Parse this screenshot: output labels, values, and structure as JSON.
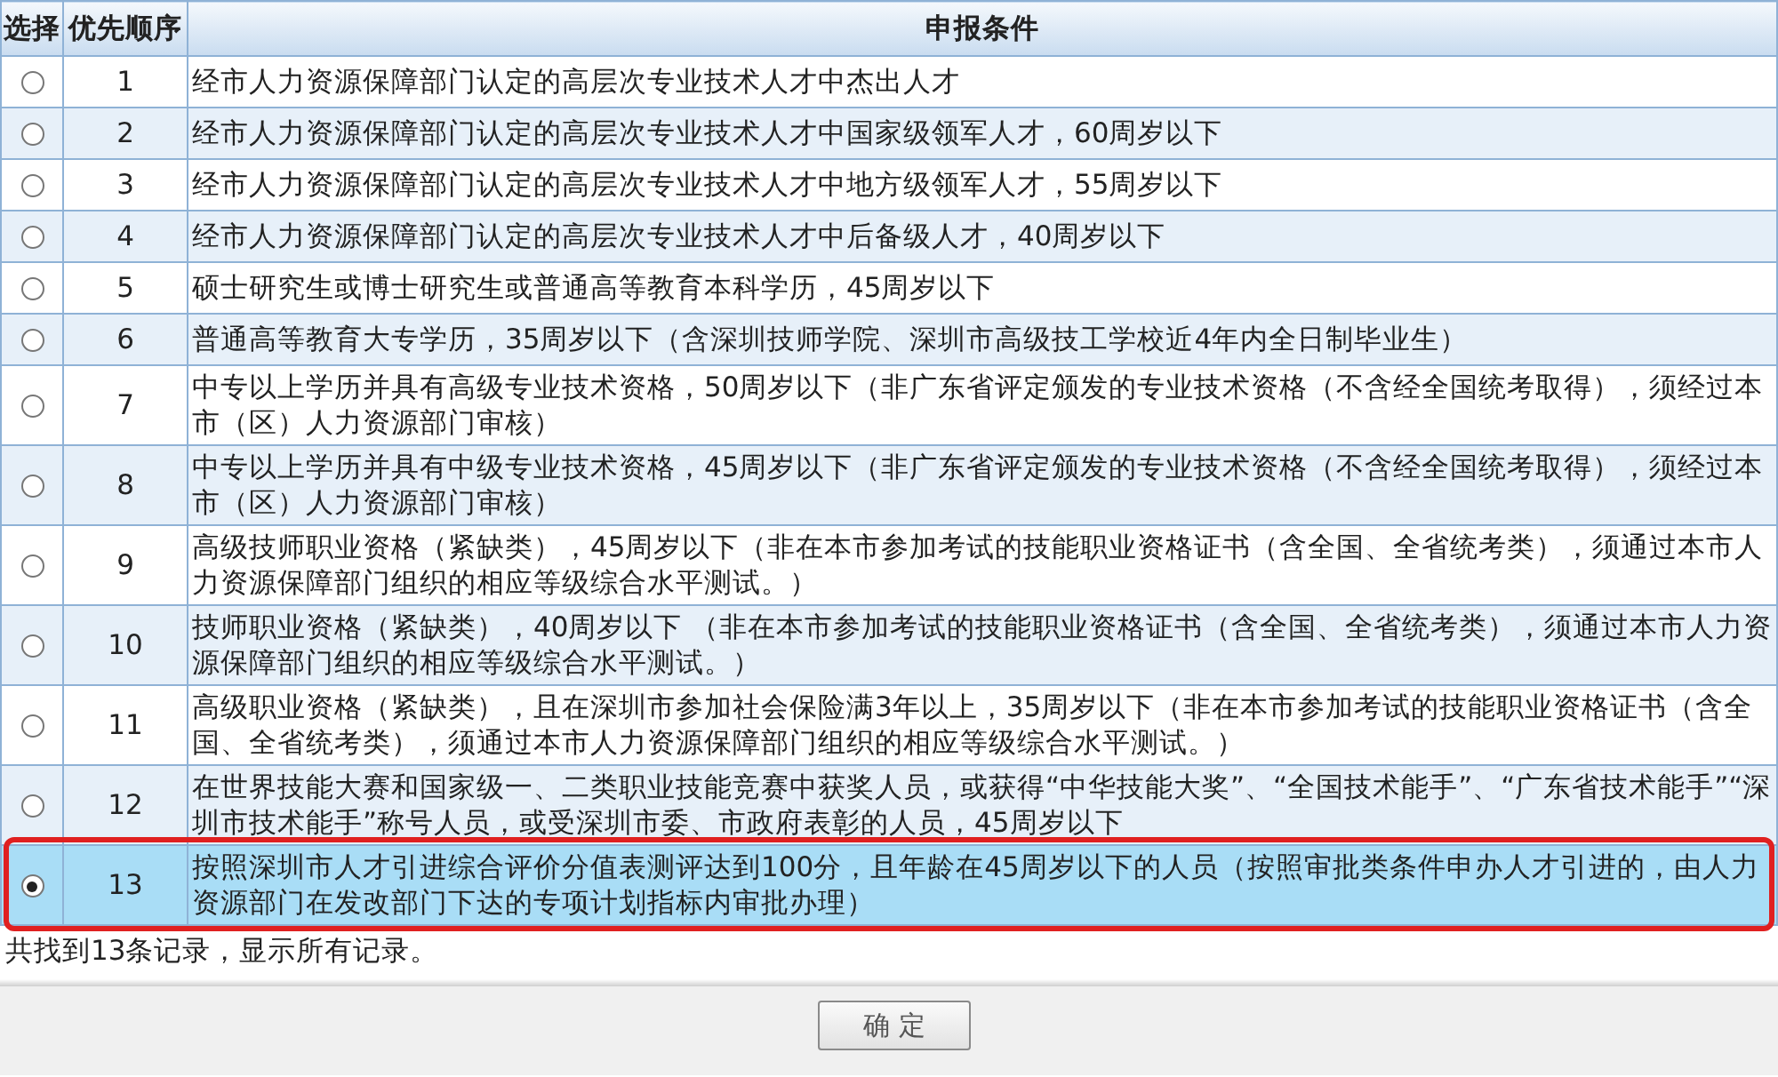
{
  "table": {
    "columns": [
      "选择",
      "优先顺序",
      "申报条件"
    ],
    "rows": [
      {
        "order": "1",
        "condition": "经市人力资源保障部门认定的高层次专业技术人才中杰出人才",
        "selected": false,
        "highlighted": false
      },
      {
        "order": "2",
        "condition": "经市人力资源保障部门认定的高层次专业技术人才中国家级领军人才，60周岁以下",
        "selected": false,
        "highlighted": false
      },
      {
        "order": "3",
        "condition": "经市人力资源保障部门认定的高层次专业技术人才中地方级领军人才，55周岁以下",
        "selected": false,
        "highlighted": false
      },
      {
        "order": "4",
        "condition": "经市人力资源保障部门认定的高层次专业技术人才中后备级人才，40周岁以下",
        "selected": false,
        "highlighted": false
      },
      {
        "order": "5",
        "condition": "硕士研究生或博士研究生或普通高等教育本科学历，45周岁以下",
        "selected": false,
        "highlighted": false
      },
      {
        "order": "6",
        "condition": "普通高等教育大专学历，35周岁以下（含深圳技师学院、深圳市高级技工学校近4年内全日制毕业生）",
        "selected": false,
        "highlighted": false
      },
      {
        "order": "7",
        "condition": "中专以上学历并具有高级专业技术资格，50周岁以下（非广东省评定颁发的专业技术资格（不含经全国统考取得），须经过本市（区）人力资源部门审核）",
        "selected": false,
        "highlighted": false
      },
      {
        "order": "8",
        "condition": "中专以上学历并具有中级专业技术资格，45周岁以下（非广东省评定颁发的专业技术资格（不含经全国统考取得），须经过本市（区）人力资源部门审核）",
        "selected": false,
        "highlighted": false
      },
      {
        "order": "9",
        "condition": "高级技师职业资格（紧缺类），45周岁以下（非在本市参加考试的技能职业资格证书（含全国、全省统考类），须通过本市人力资源保障部门组织的相应等级综合水平测试。）",
        "selected": false,
        "highlighted": false
      },
      {
        "order": "10",
        "condition": "技师职业资格（紧缺类），40周岁以下 （非在本市参加考试的技能职业资格证书（含全国、全省统考类），须通过本市人力资源保障部门组织的相应等级综合水平测试。）",
        "selected": false,
        "highlighted": false
      },
      {
        "order": "11",
        "condition": "高级职业资格（紧缺类），且在深圳市参加社会保险满3年以上，35周岁以下（非在本市参加考试的技能职业资格证书（含全国、全省统考类），须通过本市人力资源保障部门组织的相应等级综合水平测试。）",
        "selected": false,
        "highlighted": false
      },
      {
        "order": "12",
        "condition": "在世界技能大赛和国家级一、二类职业技能竞赛中获奖人员，或获得“中华技能大奖”、“全国技术能手”、“广东省技术能手”“深圳市技术能手”称号人员，或受深圳市委、市政府表彰的人员，45周岁以下",
        "selected": false,
        "highlighted": false
      },
      {
        "order": "13",
        "condition": "按照深圳市人才引进综合评价分值表测评达到100分，且年龄在45周岁以下的人员（按照审批类条件申办人才引进的，由人力资源部门在发改部门下达的专项计划指标内审批办理）",
        "selected": true,
        "highlighted": true
      }
    ]
  },
  "record_count": "共找到13条记录，显示所有记录。",
  "confirm_button": "确 定"
}
